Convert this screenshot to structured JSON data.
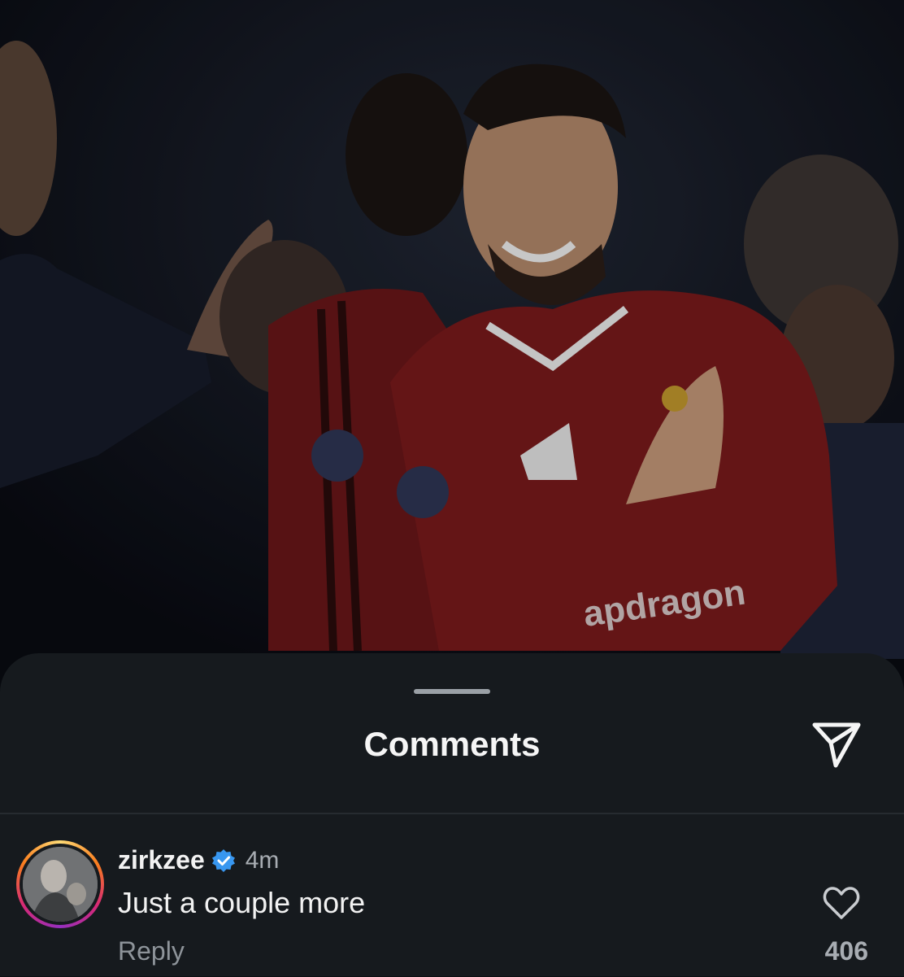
{
  "photo": {
    "description_icon": "post-photo",
    "sponsor_text": "apdragon"
  },
  "sheet": {
    "title": "Comments",
    "share_icon": "send-icon"
  },
  "comment": {
    "username": "zirkzee",
    "verified": true,
    "time": "4m",
    "text": "Just a couple more",
    "reply_label": "Reply",
    "like_count": "406",
    "like_icon": "heart-icon"
  },
  "colors": {
    "sheet_bg": "#161a1e",
    "verified": "#3897f0",
    "jersey": "#7a1a1c"
  }
}
